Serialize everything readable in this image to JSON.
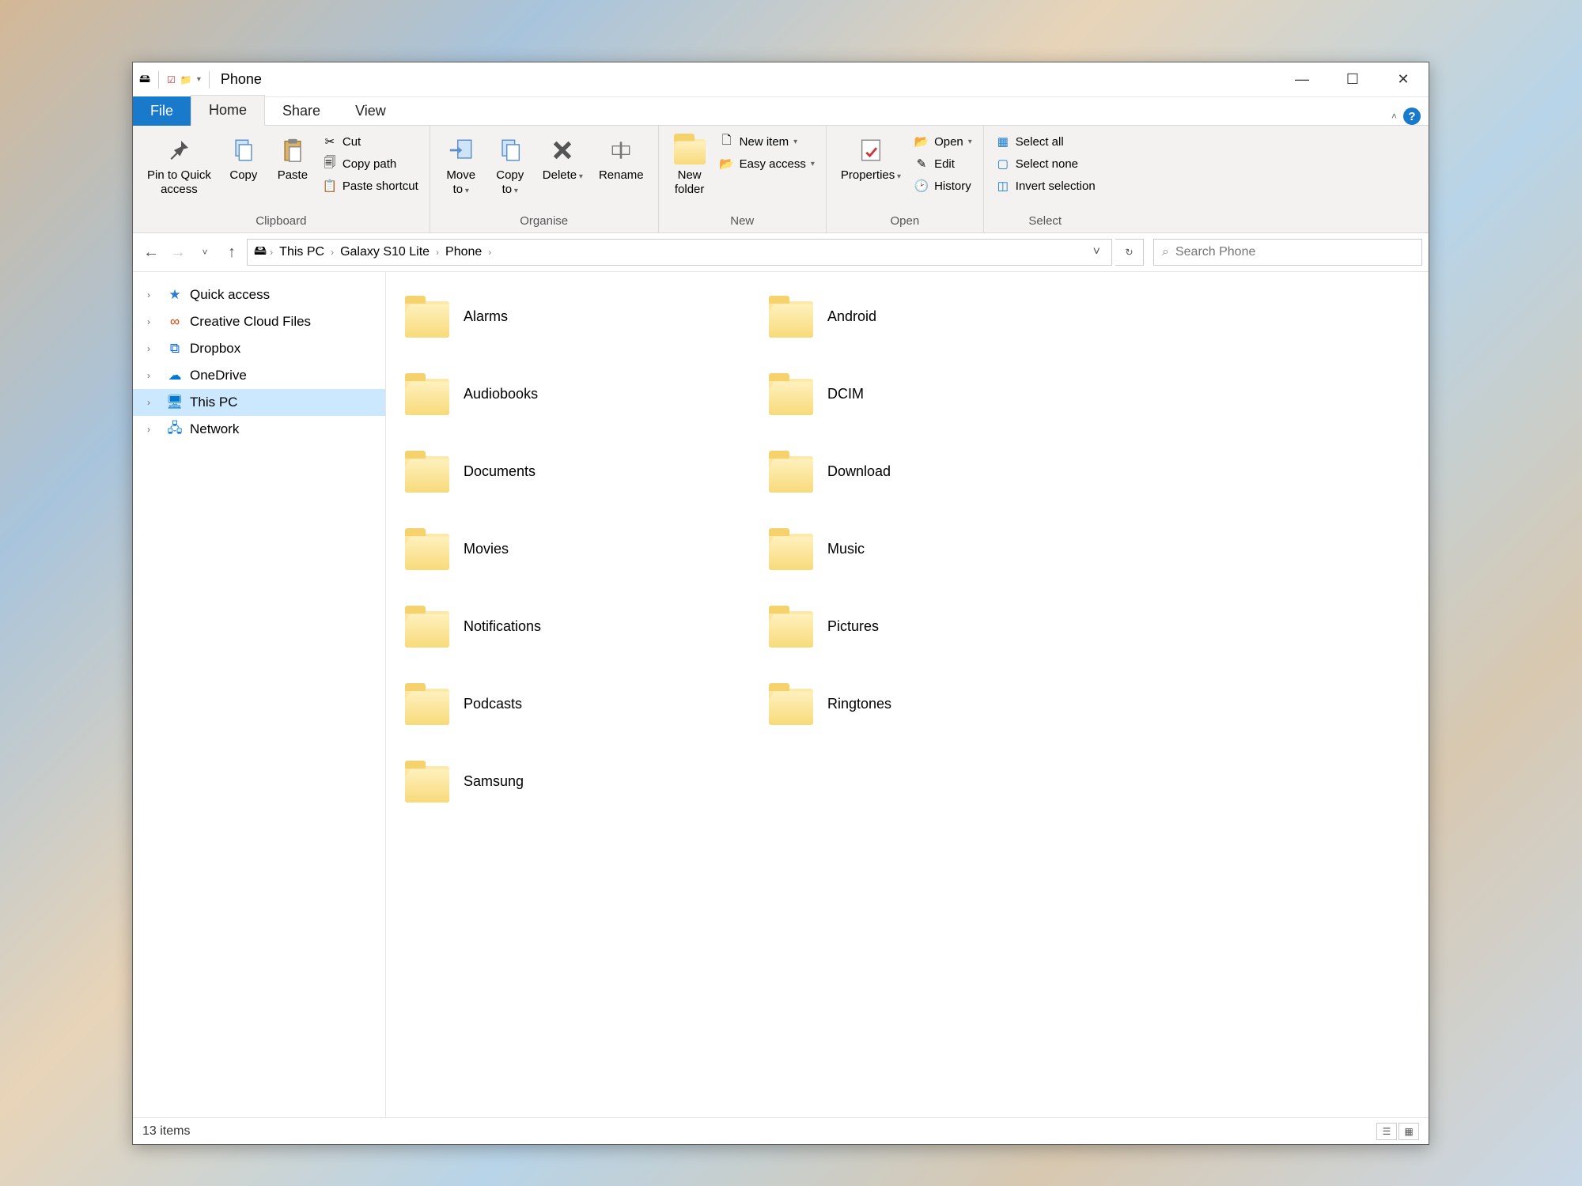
{
  "window": {
    "title": "Phone"
  },
  "tabs": {
    "file": "File",
    "home": "Home",
    "share": "Share",
    "view": "View"
  },
  "ribbon": {
    "clipboard": {
      "label": "Clipboard",
      "pin": "Pin to Quick\naccess",
      "copy": "Copy",
      "paste": "Paste",
      "cut": "Cut",
      "copy_path": "Copy path",
      "paste_shortcut": "Paste shortcut"
    },
    "organise": {
      "label": "Organise",
      "move_to": "Move\nto",
      "copy_to": "Copy\nto",
      "delete": "Delete",
      "rename": "Rename"
    },
    "new": {
      "label": "New",
      "new_folder": "New\nfolder",
      "new_item": "New item",
      "easy_access": "Easy access"
    },
    "open": {
      "label": "Open",
      "properties": "Properties",
      "open": "Open",
      "edit": "Edit",
      "history": "History"
    },
    "select": {
      "label": "Select",
      "select_all": "Select all",
      "select_none": "Select none",
      "invert": "Invert selection"
    }
  },
  "breadcrumb": [
    "This PC",
    "Galaxy S10 Lite",
    "Phone"
  ],
  "search": {
    "placeholder": "Search Phone"
  },
  "sidebar": [
    {
      "label": "Quick access",
      "icon": "star",
      "color": "#2b7cd3"
    },
    {
      "label": "Creative Cloud Files",
      "icon": "cc",
      "color": "#da3b01"
    },
    {
      "label": "Dropbox",
      "icon": "dropbox",
      "color": "#0061fe"
    },
    {
      "label": "OneDrive",
      "icon": "cloud",
      "color": "#0078d4"
    },
    {
      "label": "This PC",
      "icon": "pc",
      "color": "#0078d4",
      "selected": true
    },
    {
      "label": "Network",
      "icon": "network",
      "color": "#0078d4"
    }
  ],
  "folders": [
    "Alarms",
    "Android",
    "Audiobooks",
    "DCIM",
    "Documents",
    "Download",
    "Movies",
    "Music",
    "Notifications",
    "Pictures",
    "Podcasts",
    "Ringtones",
    "Samsung"
  ],
  "status": {
    "count": "13 items"
  }
}
